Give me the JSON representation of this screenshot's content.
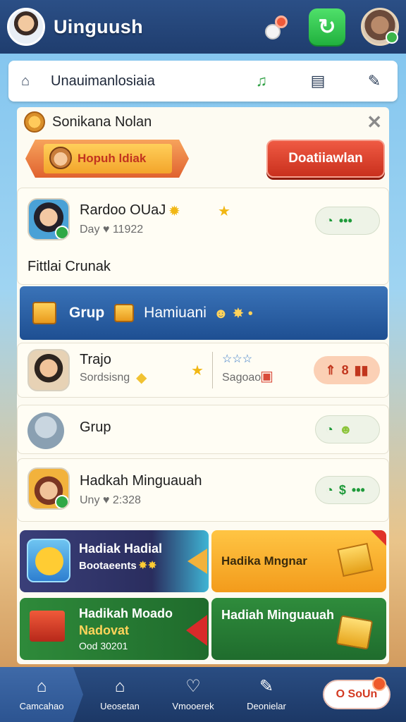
{
  "header": {
    "app_title": "Uinguush"
  },
  "subnav": {
    "label": "Unauimanlosiaia"
  },
  "notice": {
    "text": "Sonikana Nolan"
  },
  "actions": {
    "ribbon_label": "Hopuh ldiak",
    "cta_label": "Doatiiawlan"
  },
  "card1": {
    "name": "Rardoo OUaJ",
    "sub": "Day ♥ 11922",
    "section_title": "Fittlai Crunak"
  },
  "group_banner": {
    "label": "Grup",
    "sub_label": "Hamiuani"
  },
  "card2": {
    "name": "Trajo",
    "sub": "Sordsisng",
    "stars": "☆☆☆",
    "sub2": "Sagoao",
    "pill": "8"
  },
  "card3": {
    "name": "Grup"
  },
  "card4": {
    "name": "Hadkah Minguauah",
    "sub": "Uny ♥ 2:328",
    "pill": "$"
  },
  "tiles": [
    {
      "title": "Hadiak Hadial",
      "sub": "Bootaeents"
    },
    {
      "title": "Hadika Mngnar"
    },
    {
      "title": "Hadikah Moado",
      "sub": "Nadovat",
      "sub2": "Ood 30201"
    },
    {
      "title": "Hadiah Minguauah"
    }
  ],
  "bottom_nav": {
    "items": [
      {
        "label": "Camcahao",
        "icon": "home-icon"
      },
      {
        "label": "Ueosetan",
        "icon": "house-outline-icon"
      },
      {
        "label": "Vmooerek",
        "icon": "shield-icon"
      },
      {
        "label": "Deonielar",
        "icon": "edit-icon"
      }
    ],
    "cta": "O SoUn"
  },
  "colors": {
    "header_bg": "#1f3d6e",
    "accent_green": "#21b13e",
    "accent_red": "#c9301d",
    "banner_blue": "#1e4f92"
  }
}
